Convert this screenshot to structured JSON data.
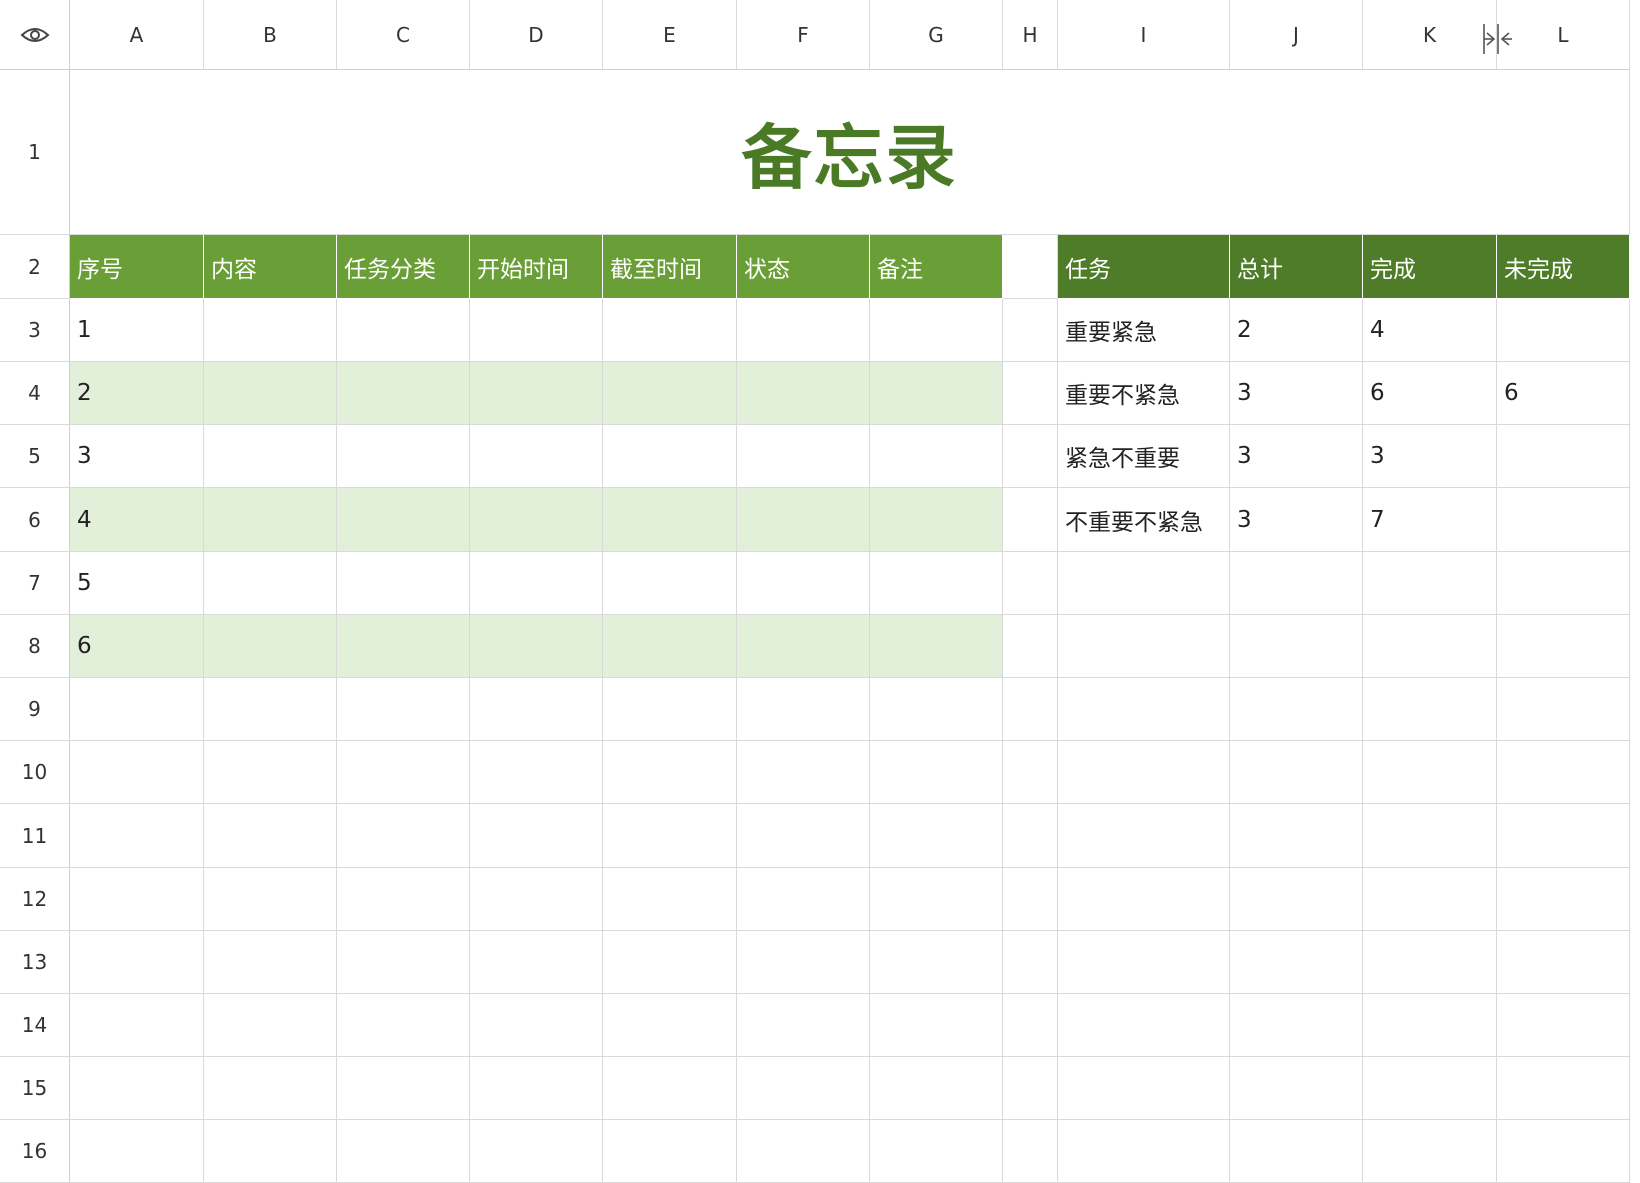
{
  "columns": [
    "A",
    "B",
    "C",
    "D",
    "E",
    "F",
    "G",
    "H",
    "I",
    "J",
    "K",
    "L"
  ],
  "rows": [
    "1",
    "2",
    "3",
    "4",
    "5",
    "6",
    "7",
    "8",
    "9",
    "10",
    "11",
    "12",
    "13",
    "14",
    "15",
    "16"
  ],
  "corner_icon": "eye-icon",
  "resize_icon": "column-resize-icon",
  "title": "备忘录",
  "memo_table": {
    "headers": [
      "序号",
      "内容",
      "任务分类",
      "开始时间",
      "截至时间",
      "状态",
      "备注"
    ],
    "rows": [
      [
        "1"
      ],
      [
        "2"
      ],
      [
        "3"
      ],
      [
        "4"
      ],
      [
        "5"
      ],
      [
        "6"
      ]
    ]
  },
  "summary_table": {
    "headers": [
      "任务",
      "总计",
      "完成",
      "未完成"
    ],
    "rows": [
      [
        "重要紧急",
        "2",
        "4",
        ""
      ],
      [
        "重要不紧急",
        "3",
        "6",
        "6"
      ],
      [
        "紧急不重要",
        "3",
        "3",
        ""
      ],
      [
        "不重要不紧急",
        "3",
        "7",
        ""
      ]
    ]
  },
  "colors": {
    "title_text": "#4a7a25",
    "memo_header_bg": "#6a9e37",
    "summary_header_bg": "#4e7c29",
    "stripe_bg": "#e2efd9",
    "gridline": "#d9d9d9"
  }
}
